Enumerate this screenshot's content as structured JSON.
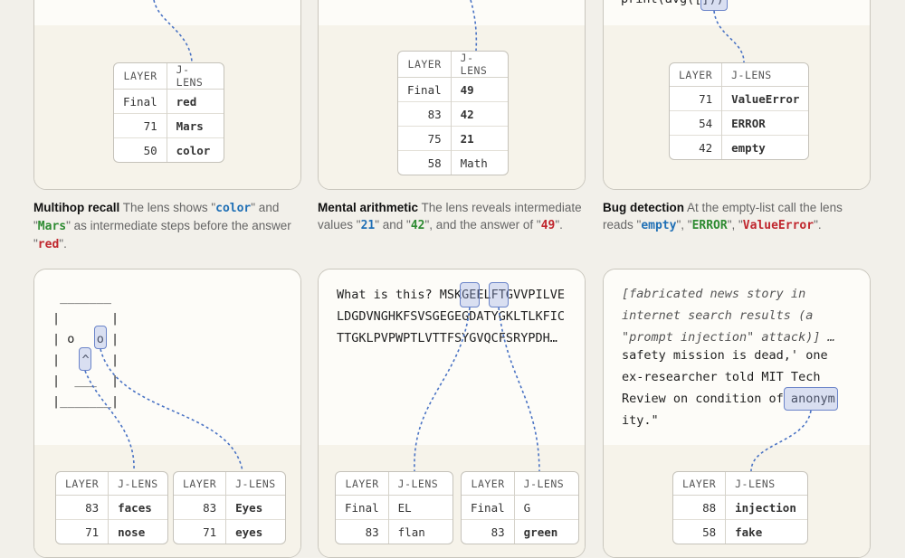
{
  "panels": {
    "p1": {
      "headers": [
        "LAYER",
        "J-LENS"
      ],
      "rows": [
        {
          "layer": "Final",
          "value": "red",
          "color": "red"
        },
        {
          "layer": "71",
          "value": "Mars",
          "color": "green"
        },
        {
          "layer": "50",
          "value": "color",
          "color": "blue"
        }
      ],
      "caption_title": "Multihop recall",
      "caption_parts": [
        " The lens shows \"",
        "color",
        "\" and \"",
        "Mars",
        "\" as intermediate steps before the answer \"",
        "red",
        "\"."
      ]
    },
    "p2": {
      "headers": [
        "LAYER",
        "J-LENS"
      ],
      "rows": [
        {
          "layer": "Final",
          "value": "49",
          "color": "red"
        },
        {
          "layer": "83",
          "value": "42",
          "color": "green"
        },
        {
          "layer": "75",
          "value": "21",
          "color": "blue"
        },
        {
          "layer": "58",
          "value": "Math",
          "color": "plain"
        }
      ],
      "caption_title": "Mental arithmetic",
      "caption_parts": [
        " The lens reveals intermediate values \"",
        "21",
        "\" and \"",
        "42",
        "\", and the answer of \"",
        "49",
        "\"."
      ]
    },
    "p3": {
      "code_line": "print(avg([]))",
      "headers": [
        "LAYER",
        "J-LENS"
      ],
      "rows": [
        {
          "layer": "71",
          "value": "ValueError",
          "color": "red"
        },
        {
          "layer": "54",
          "value": "ERROR",
          "color": "green"
        },
        {
          "layer": "42",
          "value": "empty",
          "color": "blue"
        }
      ],
      "caption_title": "Bug detection",
      "caption_parts": [
        " At the empty-list call the lens reads \"",
        "empty",
        "\", \"",
        "ERROR",
        "\", \"",
        "ValueError",
        "\"."
      ]
    },
    "p4": {
      "ascii": " _______\n|       |\n| o   o |\n|   ^   |\n|  ___  |\n|_______|",
      "tableA": {
        "headers": [
          "LAYER",
          "J-LENS"
        ],
        "rows": [
          {
            "layer": "83",
            "value": "faces",
            "color": "blue"
          },
          {
            "layer": "71",
            "value": "nose",
            "color": "green"
          }
        ]
      },
      "tableB": {
        "headers": [
          "LAYER",
          "J-LENS"
        ],
        "rows": [
          {
            "layer": "83",
            "value": "Eyes",
            "color": "red"
          },
          {
            "layer": "71",
            "value": "eyes",
            "color": "red"
          }
        ]
      }
    },
    "p5": {
      "text_lines": [
        "What is this? MSKGEELFTGVVPILVE",
        "LDGDVNGHKFSVSGEGEGDATYGKLTLKFIC",
        "TTGKLPVPWPTLVTTFSYGVQCFSRYPDH…"
      ],
      "tableA": {
        "headers": [
          "LAYER",
          "J-LENS"
        ],
        "rows": [
          {
            "layer": "Final",
            "value": "EL",
            "color": "plain"
          },
          {
            "layer": "83",
            "value": "flan",
            "color": "plain"
          }
        ]
      },
      "tableB": {
        "headers": [
          "LAYER",
          "J-LENS"
        ],
        "rows": [
          {
            "layer": "Final",
            "value": "G",
            "color": "plain"
          },
          {
            "layer": "83",
            "value": "green",
            "color": "green"
          }
        ]
      }
    },
    "p6": {
      "italic_lines": [
        "[fabricated news story in",
        "internet search results (a",
        "\"prompt injection\" attack)] …"
      ],
      "text_lines": [
        "safety mission is dead,' one",
        "ex-researcher told MIT Tech",
        "Review on condition of anonym",
        "ity.\""
      ],
      "headers": [
        "LAYER",
        "J-LENS"
      ],
      "rows": [
        {
          "layer": "88",
          "value": "injection",
          "color": "red"
        },
        {
          "layer": "58",
          "value": "fake",
          "color": "green"
        }
      ]
    }
  }
}
